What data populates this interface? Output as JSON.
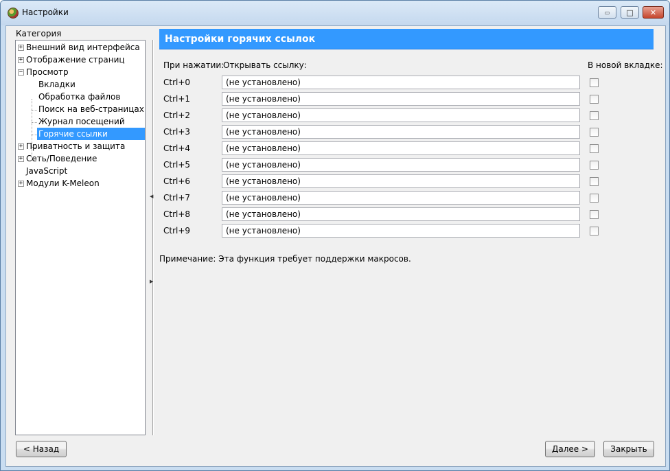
{
  "window": {
    "title": "Настройки",
    "controls": {
      "minimize": "▭",
      "maximize": "□",
      "close": "✕"
    }
  },
  "sidebar": {
    "category_label": "Категория",
    "items": [
      {
        "label": "Внешний вид интерфейса",
        "expander": "+"
      },
      {
        "label": "Отображение страниц",
        "expander": "+"
      },
      {
        "label": "Просмотр",
        "expander": "−"
      },
      {
        "label": "Вкладки"
      },
      {
        "label": "Обработка файлов"
      },
      {
        "label": "Поиск на веб-страницах"
      },
      {
        "label": "Журнал посещений"
      },
      {
        "label": "Горячие ссылки"
      },
      {
        "label": "Приватность и защита",
        "expander": "+"
      },
      {
        "label": "Сеть/Поведение",
        "expander": "+"
      },
      {
        "label": "JavaScript"
      },
      {
        "label": "Модули K-Meleon",
        "expander": "+"
      }
    ]
  },
  "panel": {
    "title": "Настройки горячих ссылок",
    "col_press": "При нажатии:",
    "col_open": "Открывать ссылку:",
    "col_new_tab": "В новой вкладке:",
    "rows": [
      {
        "key": "Ctrl+0",
        "value": "(не установлено)",
        "checked": false
      },
      {
        "key": "Ctrl+1",
        "value": "(не установлено)",
        "checked": false
      },
      {
        "key": "Ctrl+2",
        "value": "(не установлено)",
        "checked": false
      },
      {
        "key": "Ctrl+3",
        "value": "(не установлено)",
        "checked": false
      },
      {
        "key": "Ctrl+4",
        "value": "(не установлено)",
        "checked": false
      },
      {
        "key": "Ctrl+5",
        "value": "(не установлено)",
        "checked": false
      },
      {
        "key": "Ctrl+6",
        "value": "(не установлено)",
        "checked": false
      },
      {
        "key": "Ctrl+7",
        "value": "(не установлено)",
        "checked": false
      },
      {
        "key": "Ctrl+8",
        "value": "(не установлено)",
        "checked": false
      },
      {
        "key": "Ctrl+9",
        "value": "(не установлено)",
        "checked": false
      }
    ],
    "note": "Примечание: Эта функция требует поддержки макросов."
  },
  "buttons": {
    "back": "< Назад",
    "next": "Далее >",
    "close": "Закрыть"
  },
  "colors": {
    "header_bg": "#3399ff",
    "selection_bg": "#3399ff"
  }
}
